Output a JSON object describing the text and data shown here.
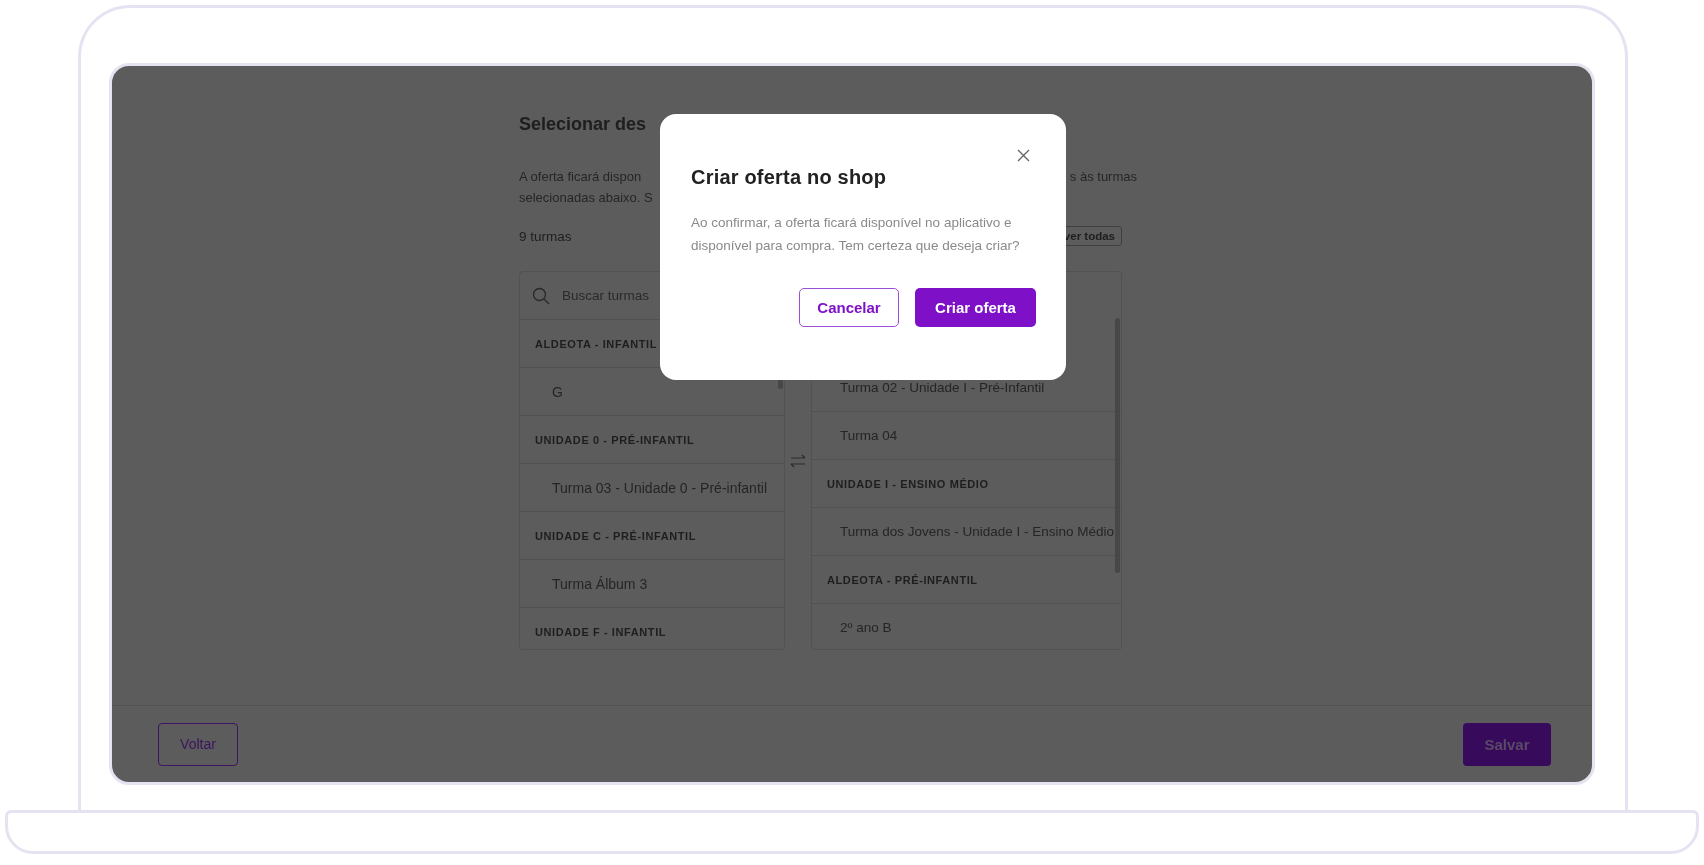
{
  "page": {
    "title": "Selecionar des",
    "description_left": [
      "A oferta ficará dispon",
      "selecionadas abaixo. S"
    ],
    "description_right": "s às turmas",
    "count": "9 turmas",
    "view_all_button": "ver todas"
  },
  "available_list": {
    "search": {
      "placeholder": "Buscar turmas"
    },
    "rows": [
      {
        "kind": "group",
        "label": "ALDEOTA - INFANTIL"
      },
      {
        "kind": "item",
        "label": "G"
      },
      {
        "kind": "group",
        "label": "UNIDADE 0 - PRÉ-INFANTIL"
      },
      {
        "kind": "item",
        "label": "Turma 03 - Unidade 0 - Pré-infantil"
      },
      {
        "kind": "group",
        "label": "UNIDADE C - PRÉ-INFANTIL"
      },
      {
        "kind": "item",
        "label": "Turma Álbum 3"
      },
      {
        "kind": "group",
        "label": "UNIDADE F - INFANTIL"
      }
    ]
  },
  "selected_list": {
    "rows": [
      {
        "kind": "item",
        "label": "Turma 02 - Unidade I - Pré-Infantil"
      },
      {
        "kind": "item",
        "label": "Turma 04"
      },
      {
        "kind": "group",
        "label": "UNIDADE I - ENSINO MÉDIO"
      },
      {
        "kind": "item",
        "label": "Turma dos Jovens - Unidade I - Ensino Médio"
      },
      {
        "kind": "group",
        "label": "ALDEOTA - PRÉ-INFANTIL"
      },
      {
        "kind": "item",
        "label": "2º ano B"
      }
    ]
  },
  "footer": {
    "back_button": "Voltar",
    "save_button": "Salvar"
  },
  "dialog": {
    "title": "Criar oferta no shop",
    "message": "Ao confirmar, a oferta ficará disponível no aplicativo e disponível para compra. Tem certeza que deseja criar?",
    "buttons": [
      {
        "label": "Cancelar",
        "kind": "secondary"
      },
      {
        "label": "Criar oferta",
        "kind": "primary"
      }
    ]
  }
}
